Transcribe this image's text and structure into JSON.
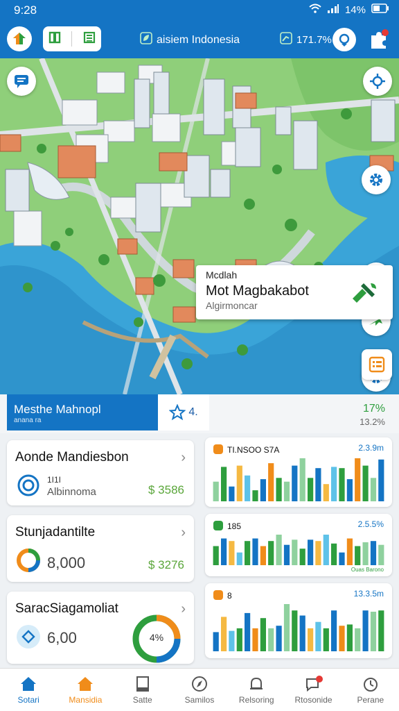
{
  "status_bar": {
    "time": "9:28",
    "battery": "14%"
  },
  "header": {
    "title": "aisiem Indonesia",
    "stat": "171.7%"
  },
  "map_popup": {
    "line1": "Mcdlah",
    "line2": "Mot Magbakabot",
    "line3": "Algirmoncar"
  },
  "summary": {
    "title": "Mesthe Mahnopl",
    "subtitle": "anana ra",
    "rating": "4.",
    "percent": "17%",
    "sub_percent": "13.2%"
  },
  "cards": [
    {
      "title": "Aonde Mandiesbon",
      "sub1": "1I1I",
      "sub2": "Albinnoma",
      "amount": "$ 3586"
    },
    {
      "title": "Stunjadantilte",
      "value": "8,000",
      "amount": "$ 3276"
    },
    {
      "title": "SaracSiagamoliat",
      "value": "6,00",
      "donut_pct": "4%"
    }
  ],
  "chart_cards": [
    {
      "header": "TI.NSOO S7A",
      "value": "2.3.9m",
      "icon_color": "#f08c1a"
    },
    {
      "header": "185",
      "value": "2.5.5%",
      "footer": "Ouas Barono",
      "icon_color": "#2e9e3e"
    },
    {
      "header": "8",
      "value": "13.3.5m",
      "icon_color": "#f08c1a"
    }
  ],
  "chart_data": [
    {
      "type": "bar",
      "values": [
        32,
        56,
        24,
        58,
        42,
        18,
        36,
        62,
        38,
        32,
        58,
        70,
        38,
        54,
        28,
        56,
        54,
        36,
        70,
        58,
        38,
        68
      ]
    },
    {
      "type": "bar",
      "values": [
        30,
        42,
        38,
        20,
        38,
        42,
        30,
        38,
        48,
        32,
        40,
        26,
        40,
        38,
        48,
        34,
        20,
        42,
        30,
        36,
        38,
        32
      ]
    },
    {
      "type": "bar",
      "values": [
        30,
        54,
        32,
        36,
        60,
        36,
        52,
        36,
        40,
        74,
        64,
        56,
        36,
        46,
        36,
        64,
        40,
        42,
        36,
        64,
        62,
        64
      ]
    }
  ],
  "nav": [
    {
      "label": "Sotari",
      "icon": "home-icon"
    },
    {
      "label": "Mansidia",
      "icon": "house-orange-icon"
    },
    {
      "label": "Satte",
      "icon": "book-icon"
    },
    {
      "label": "Samilos",
      "icon": "compass-icon"
    },
    {
      "label": "Relsoring",
      "icon": "bell-icon"
    },
    {
      "label": "Rtosonide",
      "icon": "chat-icon"
    },
    {
      "label": "Perane",
      "icon": "timer-icon"
    }
  ]
}
